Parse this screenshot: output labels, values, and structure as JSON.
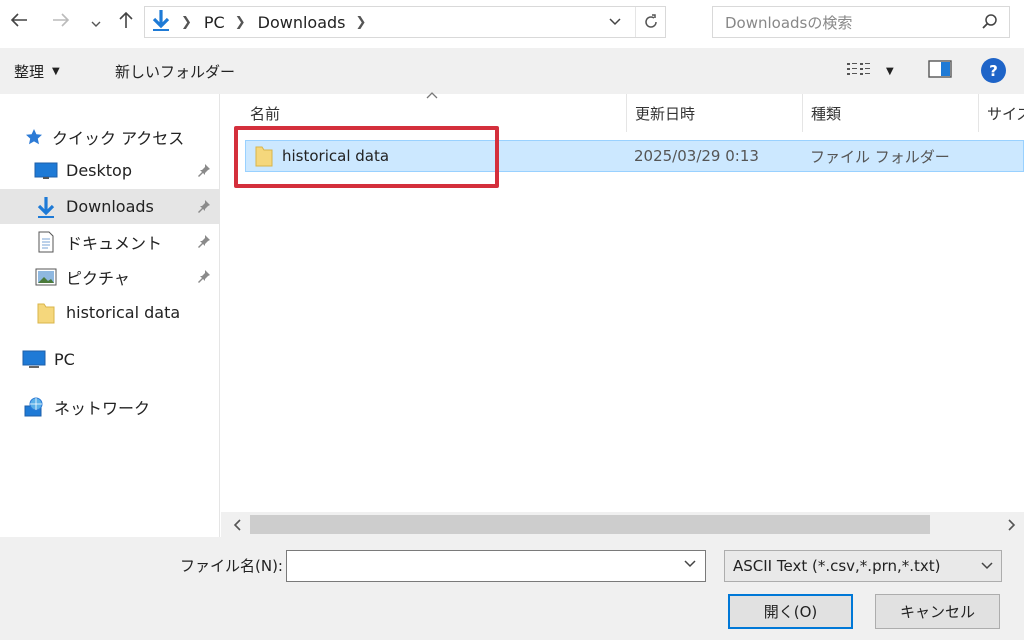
{
  "colors": {
    "accent": "#0078d7",
    "selection_bg": "#cce8ff",
    "highlight_box": "#d42f3c",
    "folder": "#f5d77c",
    "help": "#1e64c8"
  },
  "nav": {
    "back_icon": "arrow-left-icon",
    "forward_icon": "arrow-right-icon",
    "recent_icon": "chevron-down-icon",
    "up_icon": "arrow-up-icon",
    "breadcrumb": [
      "PC",
      "Downloads"
    ],
    "search_placeholder": "Downloadsの検索"
  },
  "toolbar": {
    "organize": "整理",
    "new_folder": "新しいフォルダー"
  },
  "sidebar": {
    "items": [
      {
        "label": "クイック アクセス",
        "icon": "star-icon"
      },
      {
        "label": "Desktop",
        "icon": "desktop-icon",
        "pinned": true
      },
      {
        "label": "Downloads",
        "icon": "download-icon",
        "pinned": true,
        "selected": true
      },
      {
        "label": "ドキュメント",
        "icon": "document-icon",
        "pinned": true
      },
      {
        "label": "ピクチャ",
        "icon": "picture-icon",
        "pinned": true
      },
      {
        "label": "historical data",
        "icon": "folder-icon"
      },
      {
        "label": "PC",
        "icon": "computer-icon"
      },
      {
        "label": "ネットワーク",
        "icon": "network-icon"
      }
    ]
  },
  "columns": {
    "name": "名前",
    "modified": "更新日時",
    "type": "種類",
    "size": "サイズ"
  },
  "files": [
    {
      "name": "historical data",
      "modified": "2025/03/29 0:13",
      "type": "ファイル フォルダー",
      "selected": true
    }
  ],
  "footer": {
    "filename_label": "ファイル名(N):",
    "filename_value": "",
    "filter_selected": "ASCII Text (*.csv,*.prn,*.txt)",
    "open_button": "開く(O)",
    "cancel_button": "キャンセル"
  }
}
